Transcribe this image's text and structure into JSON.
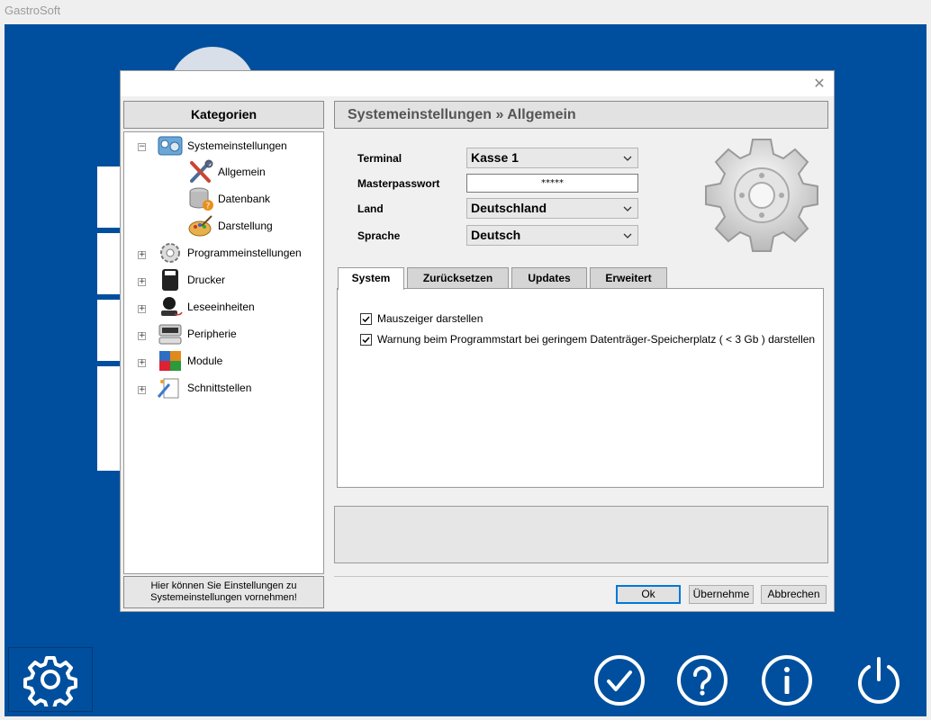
{
  "app": {
    "title": "GastroSoft"
  },
  "dialog": {
    "categories_title": "Kategorien",
    "tree": {
      "root": {
        "label": "Systemeinstellungen",
        "expander": "−"
      },
      "children": [
        {
          "label": "Allgemein",
          "icon": "tools-icon"
        },
        {
          "label": "Datenbank",
          "icon": "database-icon"
        },
        {
          "label": "Darstellung",
          "icon": "palette-icon"
        }
      ],
      "others": [
        {
          "label": "Programmeinstellungen",
          "expander": "+",
          "icon": "cogs-icon"
        },
        {
          "label": "Drucker",
          "expander": "+",
          "icon": "printer-icon"
        },
        {
          "label": "Leseeinheiten",
          "expander": "+",
          "icon": "reader-icon"
        },
        {
          "label": "Peripherie",
          "expander": "+",
          "icon": "peripheral-icon"
        },
        {
          "label": "Module",
          "expander": "+",
          "icon": "puzzle-icon"
        },
        {
          "label": "Schnittstellen",
          "expander": "+",
          "icon": "interface-icon"
        }
      ]
    },
    "category_hint_line1": "Hier können Sie Einstellungen zu",
    "category_hint_line2": "Systemeinstellungen vornehmen!",
    "section_title": "Systemeinstellungen » Allgemein",
    "fields": {
      "terminal": {
        "label": "Terminal",
        "value": "Kasse 1"
      },
      "masterpasswort": {
        "label": "Masterpasswort",
        "value": "*****"
      },
      "land": {
        "label": "Land",
        "value": "Deutschland"
      },
      "sprache": {
        "label": "Sprache",
        "value": "Deutsch"
      }
    },
    "tabs": [
      {
        "label": "System",
        "active": true
      },
      {
        "label": "Zurücksetzen",
        "active": false
      },
      {
        "label": "Updates",
        "active": false
      },
      {
        "label": "Erweitert",
        "active": false
      }
    ],
    "options": [
      {
        "label": "Mauszeiger darstellen",
        "checked": true
      },
      {
        "label": "Warnung beim Programmstart bei geringem Datenträger-Speicherplatz ( < 3 Gb ) darstellen",
        "checked": true
      }
    ],
    "buttons": {
      "ok": "Ok",
      "apply": "Übernehme",
      "cancel": "Abbrechen"
    }
  },
  "taskbar": {
    "icons": [
      "settings-gear-icon",
      "checkmark-icon",
      "help-icon",
      "info-icon",
      "power-icon"
    ]
  },
  "colors": {
    "desktop": "#004f9e",
    "dialog": "#f0f0f0",
    "accent": "#0078d7"
  }
}
